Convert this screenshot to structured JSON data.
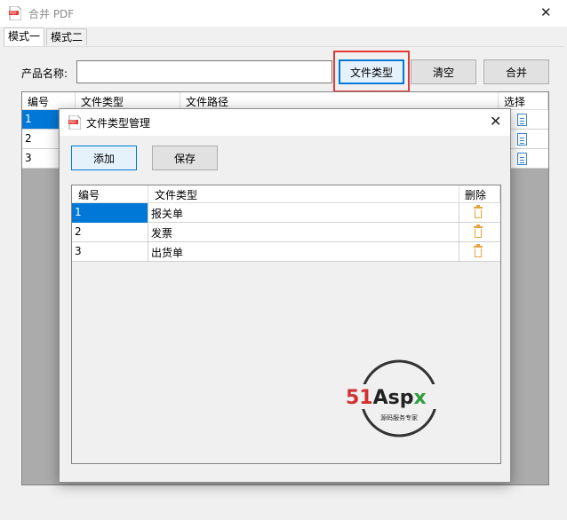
{
  "window": {
    "title": "合并 PDF",
    "close_glyph": "✕"
  },
  "tabs": [
    {
      "label": "模式一",
      "active": true
    },
    {
      "label": "模式二",
      "active": false
    }
  ],
  "form": {
    "product_label": "产品名称:",
    "product_value": "",
    "buttons": {
      "file_type": "文件类型",
      "clear": "清空",
      "merge": "合并"
    }
  },
  "main_grid": {
    "columns": [
      "编号",
      "文件类型",
      "文件路径",
      "选择"
    ],
    "rows": [
      {
        "id": "1",
        "type": "",
        "path": "",
        "selected": true
      },
      {
        "id": "2",
        "type": "",
        "path": "",
        "selected": false
      },
      {
        "id": "3",
        "type": "",
        "path": "",
        "selected": false
      }
    ]
  },
  "dialog": {
    "title": "文件类型管理",
    "close_glyph": "✕",
    "buttons": {
      "add": "添加",
      "save": "保存"
    },
    "grid": {
      "columns": [
        "编号",
        "文件类型",
        "删除"
      ],
      "rows": [
        {
          "id": "1",
          "type": "报关单"
        },
        {
          "id": "2",
          "type": "发票"
        },
        {
          "id": "3",
          "type": "出货单"
        }
      ]
    }
  },
  "watermark": {
    "brand": "51Aspx",
    "tagline": "源码服务专家"
  },
  "colors": {
    "accent": "#0078d7",
    "highlight": "#e53935",
    "trash": "#e8a33d"
  }
}
